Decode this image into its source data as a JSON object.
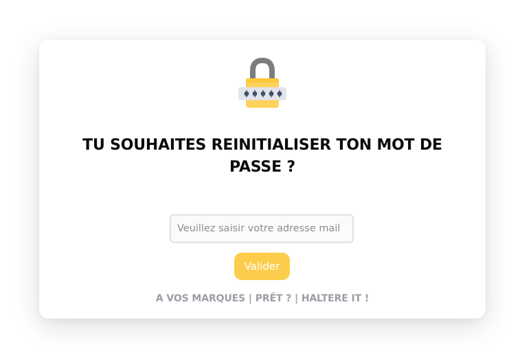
{
  "form": {
    "title": "TU SOUHAITES REINITIALISER TON MOT DE PASSE ?",
    "email_placeholder": "Veuillez saisir votre adresse mail",
    "email_value": "",
    "submit_label": "Valider"
  },
  "footer": {
    "tagline": "A VOS MARQUES | PRÊT ? | HALTERE IT !"
  },
  "icons": {
    "header_icon": "padlock-password-icon"
  },
  "colors": {
    "accent": "#fccd4b",
    "lock_shackle": "#7d7d7d",
    "lock_body": "#fdd15a",
    "password_strip": "#e3e3ea",
    "password_dots": "#3e4f6b",
    "footer_text": "#9c9ea6",
    "title_text": "#0b0b0b"
  }
}
